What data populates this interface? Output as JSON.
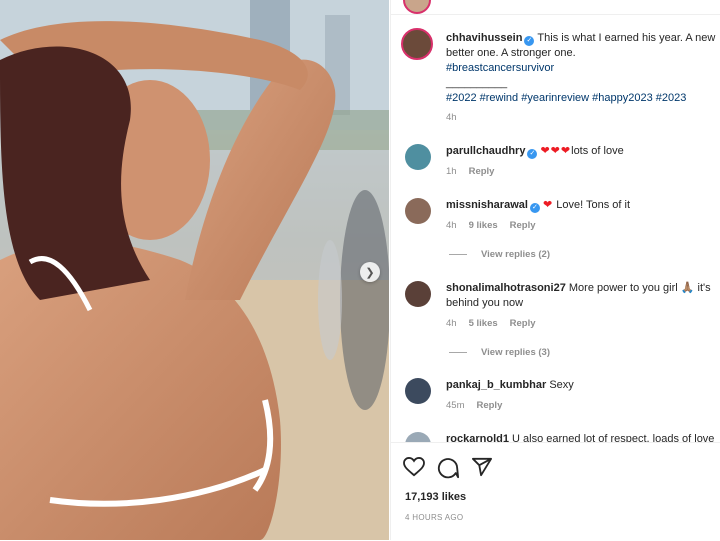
{
  "post": {
    "author": "chhavihussein",
    "caption_line1": "This is what I earned his year. A new",
    "caption_line2": "better one. A stronger one.",
    "hashtag1": "#breastcancersurvivor",
    "separator": "__________",
    "hashtags2": "#2022 #rewind #yearinreview #happy2023 #2023",
    "time": "4h",
    "likes": "17,193 likes",
    "posted_ago": "4 HOURS AGO"
  },
  "comments": [
    {
      "user": "parullchaudhry",
      "verified": true,
      "hearts": "❤❤❤",
      "text": "lots of love",
      "time": "1h",
      "reply": "Reply"
    },
    {
      "user": "missnisharawal",
      "verified": true,
      "hearts": "❤",
      "text": "Love! Tons of it",
      "time": "4h",
      "likes": "9 likes",
      "reply": "Reply",
      "view_replies": "View replies (2)"
    },
    {
      "user": "shonalimalhotrasoni27",
      "text": "More power to you girl 🙏🏽 it's",
      "text2": "behind you now",
      "time": "4h",
      "likes": "5 likes",
      "reply": "Reply",
      "view_replies": "View replies (3)"
    },
    {
      "user": "pankaj_b_kumbhar",
      "text": "Sexy",
      "time": "45m",
      "reply": "Reply"
    },
    {
      "user": "rockarnold1",
      "text": "U also earned lot of respect, loads of love"
    }
  ],
  "icons": [
    "heart-icon",
    "comment-icon",
    "share-icon",
    "verified-icon",
    "chevron-right-icon"
  ],
  "colors": {
    "link": "#00376b",
    "verified": "#3897f0",
    "meta": "#8e8e8e"
  }
}
